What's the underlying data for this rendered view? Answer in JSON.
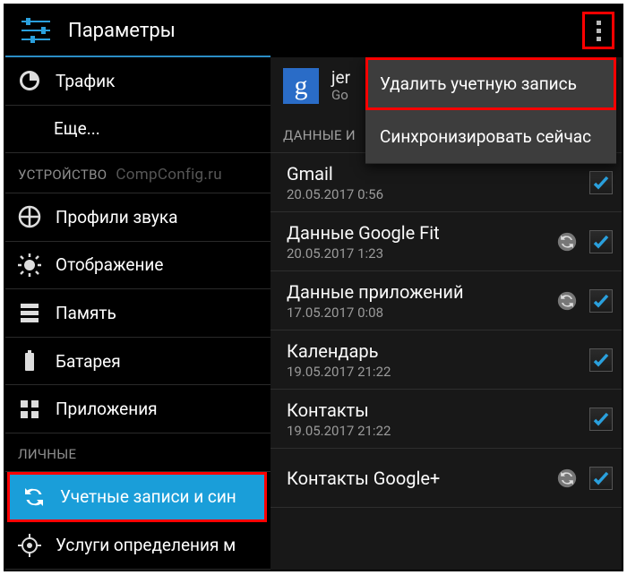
{
  "header": {
    "title": "Параметры"
  },
  "sidebar": {
    "items": [
      {
        "label": "Трафик"
      },
      {
        "label": "Еще..."
      }
    ],
    "sectionDevice": "УСТРОЙСТВО",
    "watermark": "CompConfig.ru",
    "device": [
      {
        "label": "Профили звука"
      },
      {
        "label": "Отображение"
      },
      {
        "label": "Память"
      },
      {
        "label": "Батарея"
      },
      {
        "label": "Приложения"
      }
    ],
    "sectionPersonal": "ЛИЧНЫЕ",
    "personal": [
      {
        "label": "Учетные записи и син"
      },
      {
        "label": "Услуги определения м"
      }
    ]
  },
  "panel": {
    "account": {
      "name": "jer",
      "provider": "Go"
    },
    "dataHeader": "ДАННЫЕ И",
    "rows": [
      {
        "title": "Gmail",
        "sub": "20.05.2017 0:56",
        "sync": false
      },
      {
        "title": "Данные Google Fit",
        "sub": "20.05.2017 1:23",
        "sync": true
      },
      {
        "title": "Данные приложений",
        "sub": "17.05.2017 0:08",
        "sync": true
      },
      {
        "title": "Календарь",
        "sub": "19.05.2017 21:22",
        "sync": false
      },
      {
        "title": "Контакты",
        "sub": "19.05.2017 21:22",
        "sync": false
      },
      {
        "title": "Контакты Google+",
        "sub": "",
        "sync": true
      }
    ]
  },
  "menu": {
    "items": [
      "Удалить учетную запись",
      "Синхронизировать сейчас"
    ]
  }
}
